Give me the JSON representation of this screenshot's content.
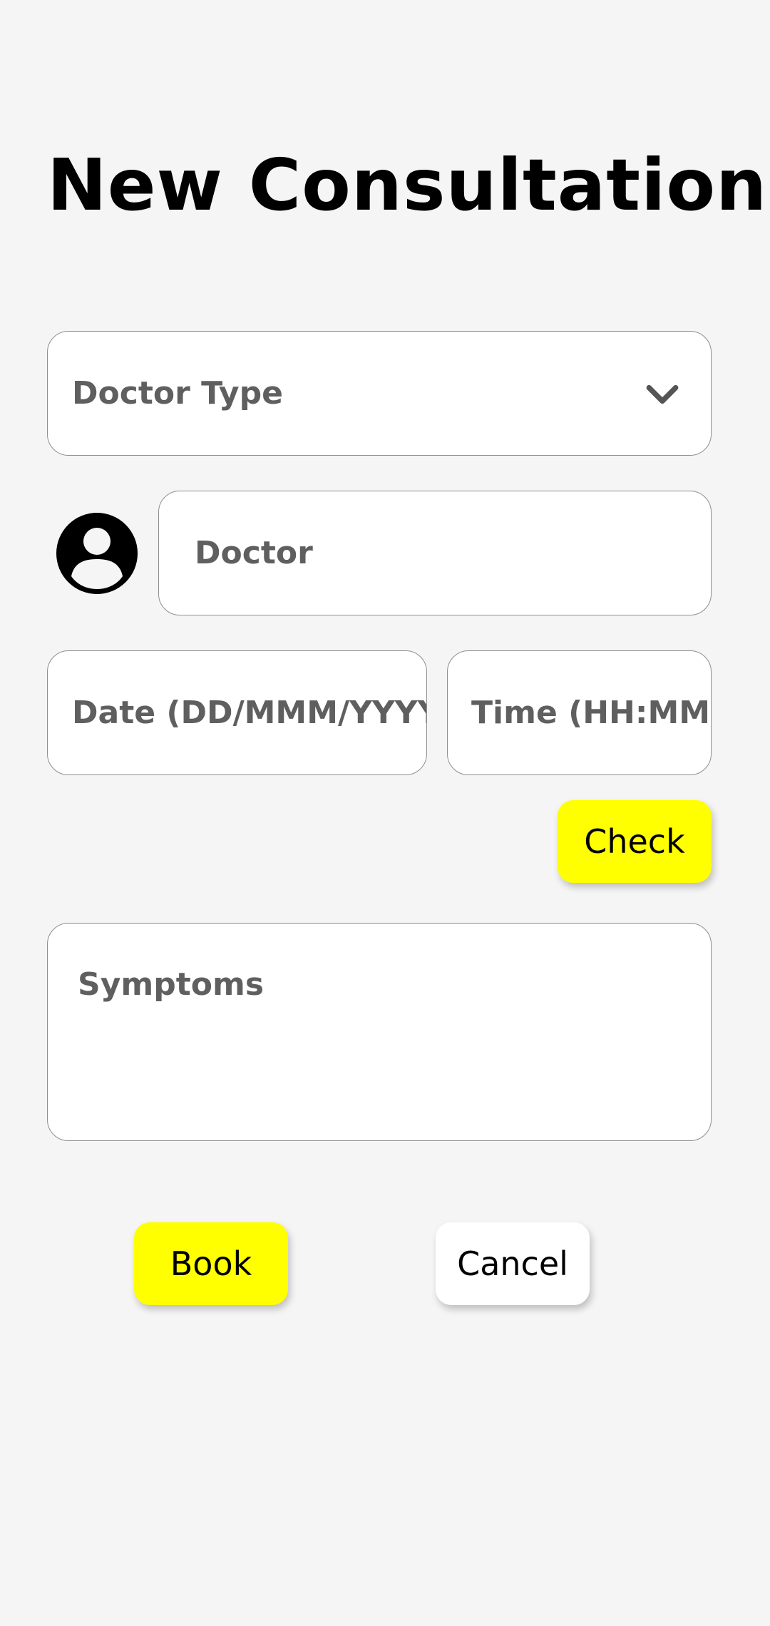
{
  "header": {
    "title": "New Consultation"
  },
  "form": {
    "doctor_type": {
      "placeholder": "Doctor Type",
      "value": "",
      "icon": "chevron-down-icon"
    },
    "doctor": {
      "placeholder": "Doctor",
      "value": "",
      "icon": "user-avatar-icon"
    },
    "date": {
      "placeholder": "Date (DD/MMM/YYYY",
      "value": ""
    },
    "time": {
      "placeholder": "Time (HH:MM)",
      "value": ""
    },
    "check_label": "Check",
    "symptoms": {
      "placeholder": "Symptoms",
      "value": ""
    }
  },
  "actions": {
    "book_label": "Book",
    "cancel_label": "Cancel"
  },
  "colors": {
    "background": "#f5f5f5",
    "accent": "#ffff00",
    "field_border": "#8e8e8e",
    "placeholder_text": "#5f5f5f"
  }
}
